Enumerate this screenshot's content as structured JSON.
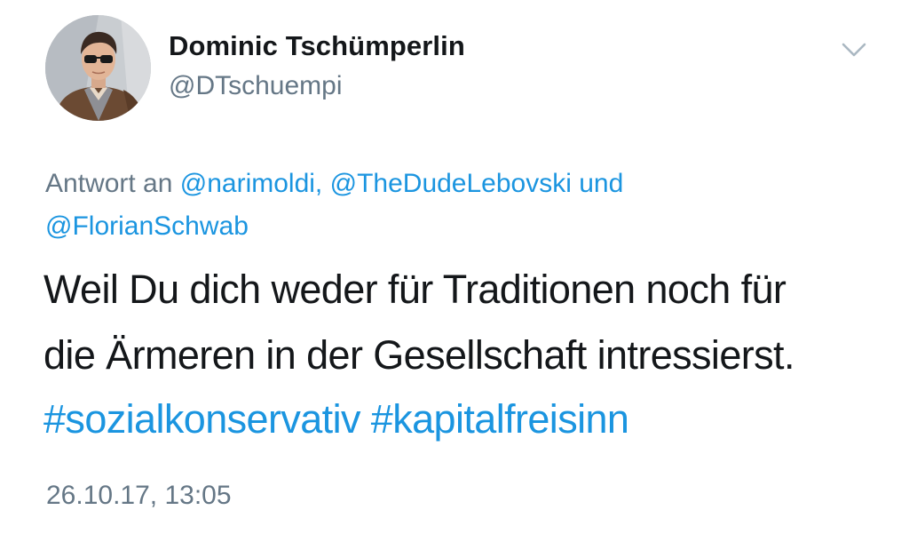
{
  "author": {
    "display_name": "Dominic Tschümperlin",
    "handle": "@DTschuempi",
    "avatar_icon": "profile-photo"
  },
  "menu": {
    "icon": "chevron-down-icon"
  },
  "reply": {
    "prefix": "Antwort an",
    "mentions": [
      "@narimoldi,",
      "@TheDudeLebovski",
      "@FlorianSchwab"
    ],
    "conjunction": "und"
  },
  "tweet": {
    "text_lines": [
      "Weil Du dich weder für Traditionen noch für",
      "die Ärmeren in der Gesellschaft intressierst."
    ],
    "hashtags": [
      "#sozialkonservativ",
      "#kapitalfreisinn"
    ]
  },
  "timestamp": "26.10.17, 13:05",
  "colors": {
    "text": "#14171a",
    "secondary": "#657786",
    "link": "#1b95e0"
  }
}
